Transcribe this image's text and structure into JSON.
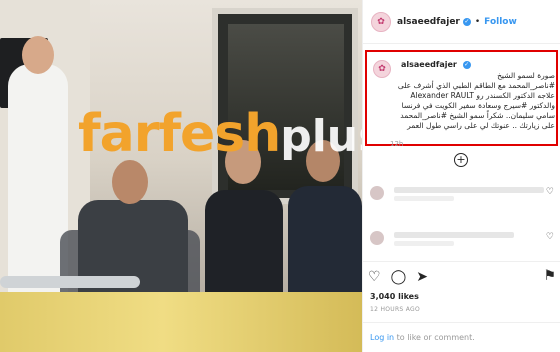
{
  "header": {
    "username": "alsaeedfajer",
    "separator": "•",
    "follow_label": "Follow"
  },
  "caption": {
    "username": "alsaeedfajer",
    "line1": "صورة لسمو الشيخ",
    "line2": "#ناصر_المحمد مع الطاقم الطبي الذي أشرف على",
    "line3": "علاجه الدكتور الكسندر رو Alexander RAULT",
    "line4": "والدكتور #سيرج وسعادة سفير الكويت في فرنسا",
    "line5": "سامي سليمان.. شكراً سمو الشيخ #ناصر_المحمد",
    "line6": "على زيارتك .. عنوتك لي على راسي طول العمر",
    "time": "12h"
  },
  "watermark": {
    "part1": "farfesh",
    "part2": "plus.com"
  },
  "stats": {
    "likes": "3,040 likes",
    "time_ago": "12 HOURS AGO"
  },
  "login": {
    "link": "Log in",
    "rest": " to like or comment."
  },
  "icons": {
    "heart": "heart-icon",
    "comment": "comment-icon",
    "share": "share-icon",
    "bookmark": "bookmark-icon",
    "plus": "plus-circle-icon",
    "verified": "verified-badge-icon"
  },
  "colors": {
    "accent": "#3897f0",
    "highlight_border": "#e00000",
    "watermark_orange": "#f2a32c"
  }
}
